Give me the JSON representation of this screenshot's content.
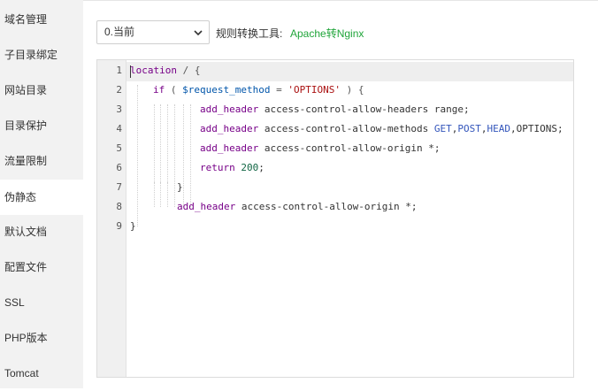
{
  "sidebar": {
    "items": [
      {
        "label": "域名管理",
        "active": false
      },
      {
        "label": "子目录绑定",
        "active": false
      },
      {
        "label": "网站目录",
        "active": false
      },
      {
        "label": "目录保护",
        "active": false
      },
      {
        "label": "流量限制",
        "active": false
      },
      {
        "label": "伪静态",
        "active": true
      },
      {
        "label": "默认文档",
        "active": false
      },
      {
        "label": "配置文件",
        "active": false
      },
      {
        "label": "SSL",
        "active": false
      },
      {
        "label": "PHP版本",
        "active": false
      },
      {
        "label": "Tomcat",
        "active": false
      }
    ]
  },
  "toolbar": {
    "select_value": "0.当前",
    "tool_label": "规则转换工具:",
    "tool_link": "Apache转Nginx"
  },
  "editor": {
    "line_numbers": [
      "1",
      "2",
      "3",
      "4",
      "5",
      "6",
      "7",
      "8",
      "9"
    ],
    "code": {
      "l1_kw": "location",
      "l1_rest": " / {",
      "l2_kw": "if",
      "l2_a": " ( ",
      "l2_var": "$request_method",
      "l2_b": " = ",
      "l2_str": "'OPTIONS'",
      "l2_c": " ) {",
      "l3_kw": "add_header",
      "l3_rest": " access-control-allow-headers range;",
      "l4_kw": "add_header",
      "l4_rest": " access-control-allow-methods ",
      "l4_m1": "GET",
      "l4_sep1": ",",
      "l4_m2": "POST",
      "l4_sep2": ",",
      "l4_m3": "HEAD",
      "l4_tail": ",OPTIONS;",
      "l5_kw": "add_header",
      "l5_rest": " access-control-allow-origin *;",
      "l6_kw": "return",
      "l6_num": " 200",
      "l6_tail": ";",
      "l7": "}",
      "l8_kw": "add_header",
      "l8_rest": " access-control-allow-origin *;",
      "l9": "}"
    }
  }
}
